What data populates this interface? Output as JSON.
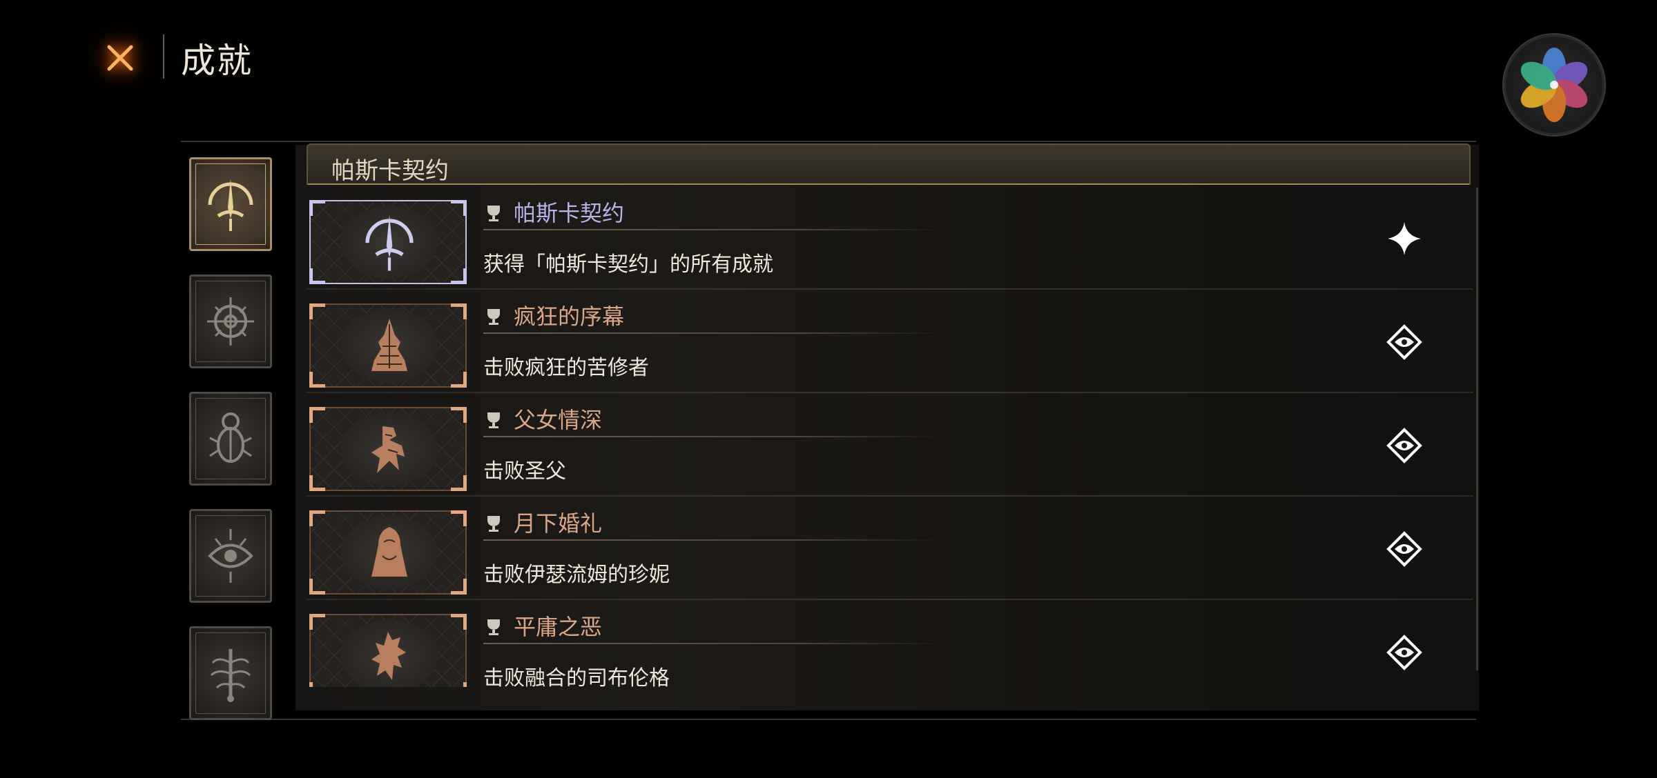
{
  "header": {
    "title": "成就"
  },
  "categories": [
    {
      "name": "pascal-contract",
      "active": true
    },
    {
      "name": "compass",
      "active": false
    },
    {
      "name": "scarab",
      "active": false
    },
    {
      "name": "eye",
      "active": false
    },
    {
      "name": "tree",
      "active": false
    }
  ],
  "section": {
    "title": "帕斯卡契约"
  },
  "achievements": [
    {
      "title": "帕斯卡契约",
      "desc": "获得「帕斯卡契约」的所有成就",
      "icon": "sunrise-crest-icon",
      "status": "sparkle-icon",
      "title_color": "#b8b3e8"
    },
    {
      "title": "疯狂的序幕",
      "desc": "击败疯狂的苦修者",
      "icon": "spiked-figure-icon",
      "status": "diamond-eye-icon",
      "title_color": "#d9a787"
    },
    {
      "title": "父女情深",
      "desc": "击败圣父",
      "icon": "twisted-hands-icon",
      "status": "diamond-eye-icon",
      "title_color": "#d9a787"
    },
    {
      "title": "月下婚礼",
      "desc": "击败伊瑟流姆的珍妮",
      "icon": "veiled-bride-icon",
      "status": "diamond-eye-icon",
      "title_color": "#d9a787"
    },
    {
      "title": "平庸之恶",
      "desc": "击败融合的司布伦格",
      "icon": "fused-beast-icon",
      "status": "diamond-eye-icon",
      "title_color": "#d9a787"
    }
  ]
}
